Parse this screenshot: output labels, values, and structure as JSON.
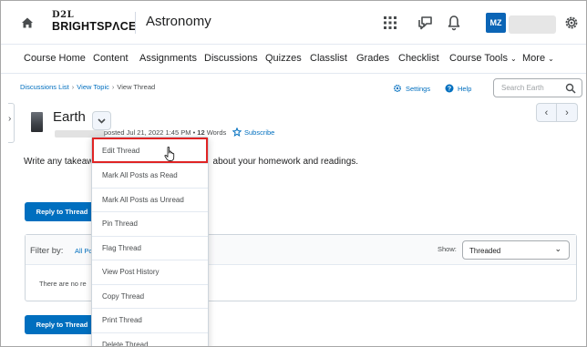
{
  "header": {
    "logo_top": "D2L",
    "logo_main": "BRIGHTSPΛCE",
    "course_title": "Astronomy",
    "avatar_initials": "MZ"
  },
  "nav": {
    "items": [
      "Course Home",
      "Content",
      "Assignments",
      "Discussions",
      "Quizzes",
      "Classlist",
      "Grades",
      "Checklist",
      "Course Tools",
      "More"
    ]
  },
  "breadcrumb": {
    "items": [
      "Discussions List",
      "View Topic"
    ],
    "current": "View Thread"
  },
  "toolbar": {
    "settings_label": "Settings",
    "help_label": "Help",
    "search_placeholder": "Search Earth"
  },
  "thread": {
    "title": "Earth",
    "posted_prefix": "posted Jul 21, 2022 1:45 PM • ",
    "word_count": "12",
    "words_label": " Words",
    "subscribe_label": "Subscribe",
    "body_start": "Write any takeaw",
    "body_end": "about your homework and readings."
  },
  "buttons": {
    "reply_label": "Reply to Thread"
  },
  "filter": {
    "filter_label": "Filter by:",
    "filter_all": "All Po",
    "show_label": "Show:",
    "show_value": "Threaded",
    "empty_message": "There are no re"
  },
  "menu": {
    "items": [
      "Edit Thread",
      "Mark All Posts as Read",
      "Mark All Posts as Unread",
      "Pin Thread",
      "Flag Thread",
      "View Post History",
      "Copy Thread",
      "Print Thread",
      "Delete Thread"
    ],
    "highlighted": "Edit Thread"
  },
  "colors": {
    "accent": "#006fbf",
    "highlight_border": "#e02424",
    "avatar_bg": "#0b65b6"
  }
}
